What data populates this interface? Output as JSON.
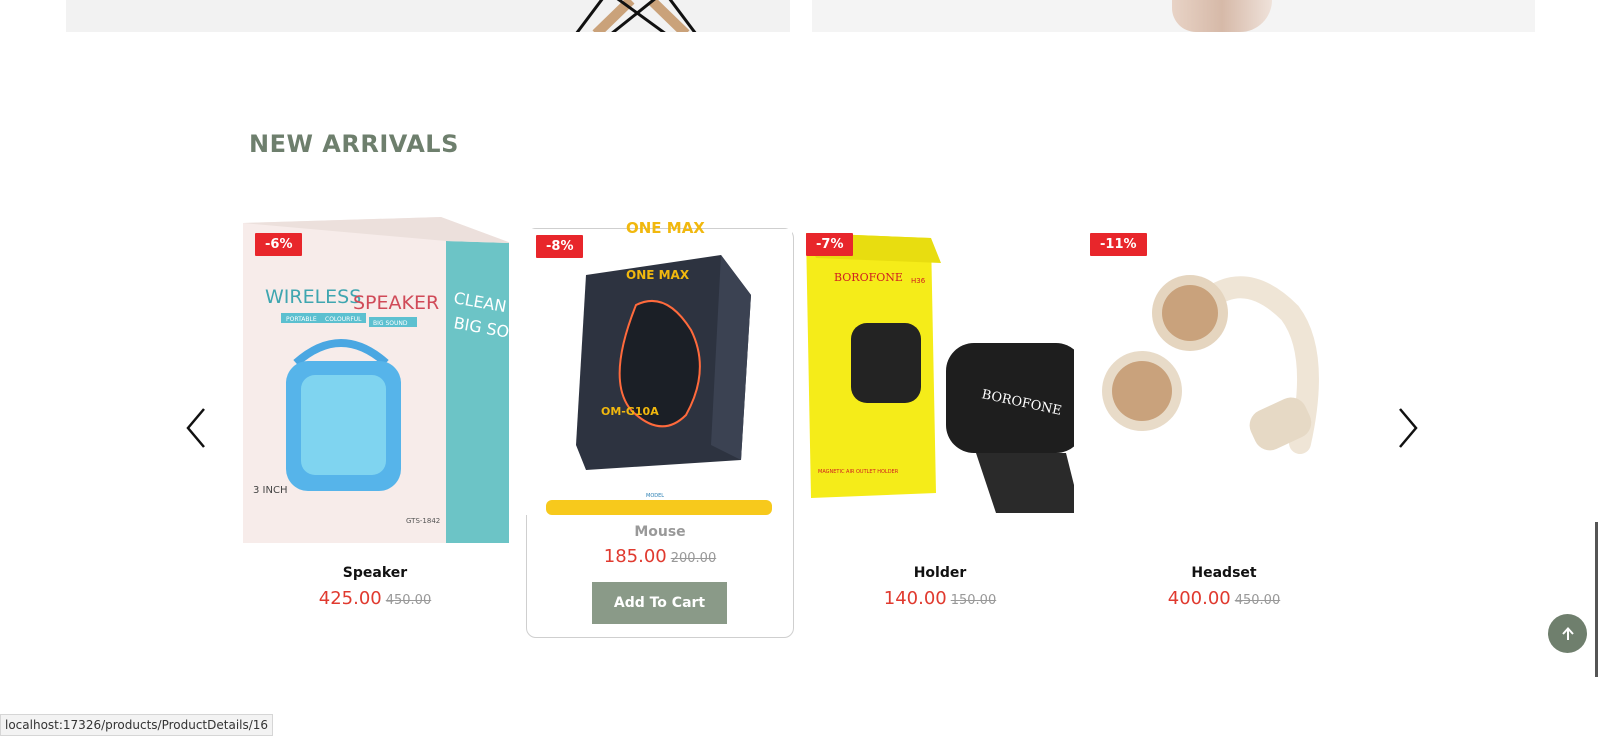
{
  "section": {
    "title": "NEW ARRIVALS"
  },
  "carousel": {
    "prev_icon": "chevron-left-icon",
    "next_icon": "chevron-right-icon"
  },
  "products": [
    {
      "name": "Speaker",
      "discount": "-6%",
      "price": "425.00",
      "old_price": "450.00",
      "box_title": "WIRELESS SPEAKER",
      "box_side": "CLEAN & BIG SOUND",
      "tags": [
        "PORTABLE",
        "COLOURFUL",
        "BIG SOUND"
      ],
      "size_label": "3 INCH",
      "model": "GTS-1842"
    },
    {
      "name": "Mouse",
      "discount": "-8%",
      "price": "185.00",
      "old_price": "200.00",
      "brand": "ONE MAX",
      "model": "OM-G10A",
      "model_label": "MODEL",
      "cta": "Add To Cart"
    },
    {
      "name": "Holder",
      "discount": "-7%",
      "price": "140.00",
      "old_price": "150.00",
      "brand": "BOROFONE",
      "model": "H36",
      "tagline": "MAGNETIC AIR OUTLET HOLDER"
    },
    {
      "name": "Headset",
      "discount": "-11%",
      "price": "400.00",
      "old_price": "450.00"
    }
  ],
  "status_bar": {
    "url": "localhost:17326/products/ProductDetails/16"
  },
  "colors": {
    "accent": "#6e7f6d",
    "sale": "#e8262b",
    "price": "#e03a2f",
    "button": "#8a9a88"
  }
}
